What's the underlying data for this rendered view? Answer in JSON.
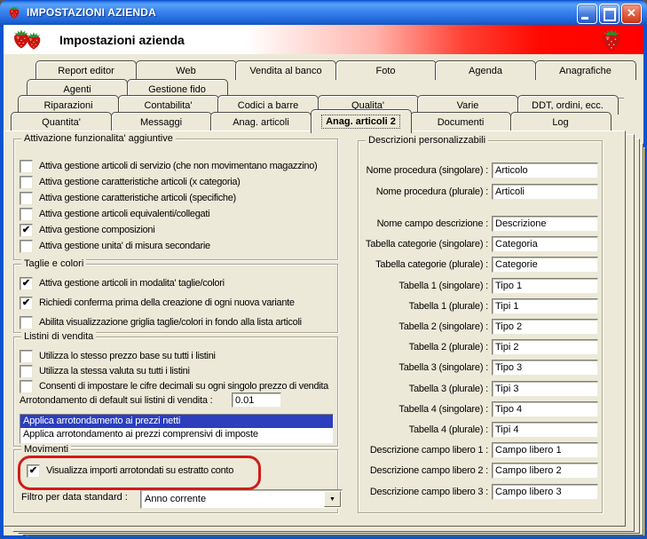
{
  "window": {
    "title": "IMPOSTAZIONI AZIENDA"
  },
  "header": {
    "title": "Impostazioni azienda"
  },
  "tabs": {
    "rows": [
      {
        "items": [
          {
            "label": "Report editor"
          },
          {
            "label": "Web"
          },
          {
            "label": "Vendita al banco"
          },
          {
            "label": "Foto"
          },
          {
            "label": "Agenda"
          },
          {
            "label": "Anagrafiche"
          }
        ]
      },
      {
        "items": [
          {
            "label": "Agenti"
          },
          {
            "label": "Gestione fido"
          }
        ]
      },
      {
        "items": [
          {
            "label": "Riparazioni"
          },
          {
            "label": "Contabilita'"
          },
          {
            "label": "Codici a barre"
          },
          {
            "label": "Qualita'"
          },
          {
            "label": "Varie"
          },
          {
            "label": "DDT, ordini, ecc."
          }
        ]
      },
      {
        "items": [
          {
            "label": "Quantita'"
          },
          {
            "label": "Messaggi"
          },
          {
            "label": "Anag. articoli"
          },
          {
            "label": "Anag. articoli 2",
            "selected": true
          },
          {
            "label": "Documenti"
          },
          {
            "label": "Log"
          }
        ]
      }
    ]
  },
  "groups": {
    "features": {
      "title": "Attivazione funzionalita' aggiuntive",
      "items": [
        {
          "label": "Attiva gestione articoli di servizio (che non movimentano magazzino)",
          "checked": false
        },
        {
          "label": "Attiva gestione caratteristiche articoli (x categoria)",
          "checked": false
        },
        {
          "label": "Attiva gestione caratteristiche articoli (specifiche)",
          "checked": false
        },
        {
          "label": "Attiva gestione articoli equivalenti/collegati",
          "checked": false
        },
        {
          "label": "Attiva gestione composizioni",
          "checked": true
        },
        {
          "label": "Attiva gestione unita' di misura secondarie",
          "checked": false
        }
      ]
    },
    "taglie": {
      "title": "Taglie e colori",
      "items": [
        {
          "label": "Attiva gestione articoli in modalita' taglie/colori",
          "checked": true
        },
        {
          "label": "Richiedi conferma prima della creazione di ogni nuova variante",
          "checked": true
        },
        {
          "label": "Abilita visualizzazione griglia taglie/colori in fondo alla lista articoli",
          "checked": false
        }
      ]
    },
    "listini": {
      "title": "Listini di vendita",
      "items": [
        {
          "label": "Utilizza lo stesso prezzo base su tutti i listini",
          "checked": false
        },
        {
          "label": "Utilizza la stessa valuta su tutti i listini",
          "checked": false
        },
        {
          "label": "Consenti di impostare le cifre decimali su ogni singolo prezzo di vendita",
          "checked": false
        }
      ],
      "rounding_label": "Arrotondamento di default sui listini di vendita :",
      "rounding_value": "0.01",
      "list_options": [
        {
          "label": "Applica arrotondamento ai prezzi netti",
          "selected": true
        },
        {
          "label": "Applica arrotondamento ai prezzi comprensivi di imposte",
          "selected": false
        }
      ]
    },
    "movimenti": {
      "title": "Movimenti",
      "items": [
        {
          "label": "Visualizza importi arrotondati su estratto conto",
          "checked": true
        }
      ],
      "filter_label": "Filtro per data standard :",
      "filter_value": "Anno corrente"
    }
  },
  "descriptions": {
    "title": "Descrizioni personalizzabili",
    "fields": [
      {
        "label": "Nome procedura (singolare) :",
        "value": "Articolo"
      },
      {
        "label": "Nome procedura (plurale) :",
        "value": "Articoli"
      },
      {
        "label": "Nome campo descrizione :",
        "value": "Descrizione"
      },
      {
        "label": "Tabella categorie (singolare) :",
        "value": "Categoria"
      },
      {
        "label": "Tabella categorie (plurale) :",
        "value": "Categorie"
      },
      {
        "label": "Tabella 1 (singolare) :",
        "value": "Tipo 1"
      },
      {
        "label": "Tabella 1 (plurale) :",
        "value": "Tipi 1"
      },
      {
        "label": "Tabella 2 (singolare) :",
        "value": "Tipo 2"
      },
      {
        "label": "Tabella 2 (plurale) :",
        "value": "Tipi 2"
      },
      {
        "label": "Tabella 3 (singolare) :",
        "value": "Tipo 3"
      },
      {
        "label": "Tabella 3 (plurale) :",
        "value": "Tipi 3"
      },
      {
        "label": "Tabella 4 (singolare) :",
        "value": "Tipo 4"
      },
      {
        "label": "Tabella 4 (plurale) :",
        "value": "Tipi 4"
      },
      {
        "label": "Descrizione campo libero 1 :",
        "value": "Campo libero 1"
      },
      {
        "label": "Descrizione campo libero 2 :",
        "value": "Campo libero 2"
      },
      {
        "label": "Descrizione campo libero 3 :",
        "value": "Campo libero 3"
      }
    ]
  },
  "colors": {
    "annotation_red": "#cf1d1a",
    "selection_blue": "#2b3fbf",
    "client_beige": "#ECE9D8"
  }
}
